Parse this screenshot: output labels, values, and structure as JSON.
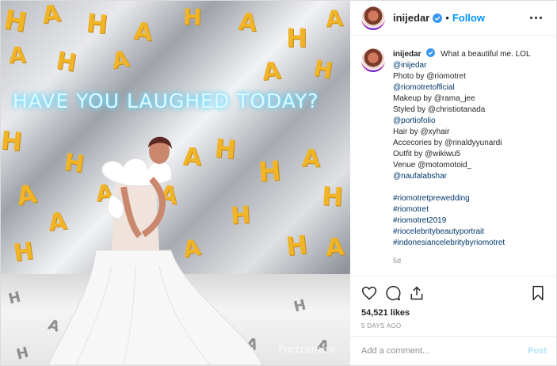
{
  "header": {
    "username": "inijedar",
    "follow_label": "Follow",
    "dot": "•"
  },
  "photo": {
    "neon_text": "HAVE YOU LAUGHED TODAY?",
    "letter": "A",
    "letter_h": "H",
    "watermark": "Portraiture",
    "description": "Woman in white ruffled gown posing in front of silver foil wall with yellow HA letters"
  },
  "caption": {
    "username": "inijedar",
    "text": "What a beautiful me. LOL",
    "lines": [
      {
        "type": "link",
        "text": "@inijedar"
      },
      {
        "type": "line",
        "text": "Photo by @riomotret"
      },
      {
        "type": "link",
        "text": "@riomotretofficial"
      },
      {
        "type": "line",
        "text": "Makeup by @rama_jee"
      },
      {
        "type": "line",
        "text": "Styled by @christiotanada"
      },
      {
        "type": "link",
        "text": "@portiofolio"
      },
      {
        "type": "line",
        "text": "Hair by @xyhair"
      },
      {
        "type": "line",
        "text": "Accecories by @rinaldyyunardi"
      },
      {
        "type": "line",
        "text": "Outfit by @wikiwu5"
      },
      {
        "type": "line",
        "text": "Venue @motomotoid_"
      },
      {
        "type": "link",
        "text": "@naufalabshar"
      }
    ],
    "hashtags": [
      "#riomotretprewedding",
      "#riomotret",
      "#riomotret2019",
      "#riocelebritybeautyportrait",
      "#indonesiancelebritybyriomotret"
    ],
    "age": "5d"
  },
  "actions": {
    "likes": "54,521 likes",
    "time_ago": "5 DAYS AGO",
    "icons": [
      "heart-icon",
      "comment-icon",
      "share-icon",
      "bookmark-icon"
    ]
  },
  "comment": {
    "placeholder": "Add a comment...",
    "post_label": "Post"
  },
  "colors": {
    "link": "#00376b",
    "follow": "#0095f6",
    "letter_yellow": "#f0b429",
    "neon": "#6fe7ff"
  }
}
